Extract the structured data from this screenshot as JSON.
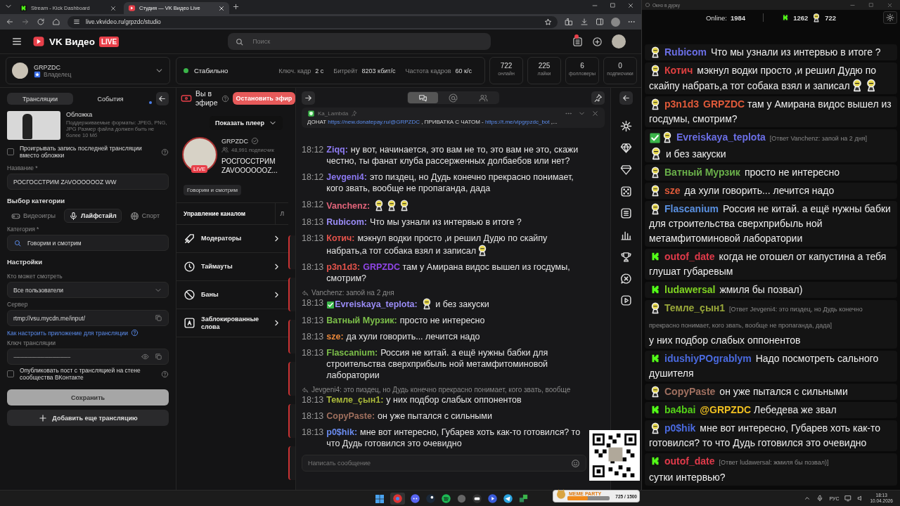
{
  "browser": {
    "tabs": [
      {
        "title": "Stream - Kick Dashboard",
        "kind": "kick",
        "selected": false
      },
      {
        "title": "Студия — VK Видео Live",
        "kind": "vk",
        "selected": true
      }
    ],
    "url": "live.vkvideo.ru/grpzdc/studio"
  },
  "header": {
    "logo": "VK Видео",
    "badge": "LIVE",
    "search": {
      "placeholder": "Поиск"
    }
  },
  "account": {
    "name": "GRPZDC",
    "role": "Владелец"
  },
  "status": {
    "label": "Стабильно",
    "metrics": [
      {
        "label": "Ключ. кадр",
        "value": "2 с"
      },
      {
        "label": "Битрейт",
        "value": "8203 кбит/с"
      },
      {
        "label": "Частота кадров",
        "value": "60 к/с"
      }
    ],
    "counters": [
      {
        "value": "722",
        "label": "онлайн"
      },
      {
        "value": "225",
        "label": "лайки"
      },
      {
        "value": "6",
        "label": "фолловеры"
      },
      {
        "value": "0",
        "label": "подписчики"
      }
    ]
  },
  "settings": {
    "tabs": [
      {
        "label": "Трансляции",
        "selected": true,
        "unread": false
      },
      {
        "label": "События",
        "selected": false,
        "unread": true
      }
    ],
    "cover": {
      "title": "Обложка",
      "hint": "Поддерживаемые форматы: JPEG, PNG, JPG Размер файла должен быть не более 10 Мб"
    },
    "replay_checkbox": {
      "label": "Проигрывать запись последней трансляции вместо обложки",
      "checked": false
    },
    "title_field": {
      "label": "Название *",
      "value": "РОСГОССТРИМ ZAVOOOOOOZ WW"
    },
    "category_section": "Выбор категории",
    "category_types": [
      {
        "label": "Видеоигры",
        "kind": "games",
        "selected": false
      },
      {
        "label": "Лайфстайл",
        "kind": "lifestyle",
        "selected": true
      },
      {
        "label": "Спорт",
        "kind": "sport",
        "selected": false
      }
    ],
    "category_field": {
      "label": "Категория *",
      "value": "Говорим и смотрим"
    },
    "settings_section": "Настройки",
    "audience_field": {
      "label": "Кто может смотреть",
      "value": "Все пользователи"
    },
    "server_field": {
      "label": "Сервер",
      "value": "rtmp://vsu.mycdn.me/input/"
    },
    "setup_link": "Как настроить приложение для трансляции",
    "key_field": {
      "label": "Ключ трансляции",
      "value": "--------------------------------------------"
    },
    "post_checkbox": {
      "label": "Опубликовать пост с трансляцией на стене сообщества ВКонтакте",
      "checked": false
    },
    "buttons": [
      {
        "label": "Сохранить",
        "kind": "primary"
      },
      {
        "label": "Добавить еще трансляцию",
        "kind": "add"
      }
    ]
  },
  "channel": {
    "live_label": "Вы в эфире",
    "stop_button": "Остановить эфир",
    "player_toggle": "Показать плеер",
    "name": "GRPZDC",
    "subscribers": "48,991 подписчик",
    "avatar_badge": "LIVE",
    "stream_title": "РОСГОССТРИМ ZAVOOOOOOZ...",
    "tag": "Говорим и смотрим",
    "manage_tabs": [
      {
        "label": "Управление каналом",
        "selected": true
      },
      {
        "label": "Л",
        "selected": false
      }
    ],
    "menu": [
      {
        "label": "Модераторы",
        "kind": "moderators"
      },
      {
        "label": "Таймауты",
        "kind": "timeouts"
      },
      {
        "label": "Баны",
        "kind": "bans"
      },
      {
        "label": "Заблокированные слова",
        "kind": "blocked_words"
      }
    ]
  },
  "chat": {
    "tabs": [
      {
        "kind": "chat",
        "selected": true
      },
      {
        "kind": "mentions",
        "selected": false
      },
      {
        "kind": "users",
        "selected": false
      }
    ],
    "pinned": {
      "author": "Ka_Lambda",
      "parts": [
        {
          "kind": "text",
          "text": "ДОНАТ "
        },
        {
          "kind": "link",
          "text": "https://new.donatepay.ru/@GRPZDC"
        },
        {
          "kind": "text",
          "text": " , ПРИВАТКА С ЧАТОМ - "
        },
        {
          "kind": "link",
          "text": "https://t.me/vipgrpzdc_bot"
        },
        {
          "kind": "text",
          "text": " ,..."
        }
      ]
    },
    "messages": [
      {
        "time": "18:12",
        "user": "Ziqq:",
        "color": "#8e7cf3",
        "parts": [
          {
            "kind": "text",
            "text": "ну вот, начинается, это вам не то, это вам не это, скажи честно, ты фанат клуба рассерженных долбаебов или нет?"
          }
        ]
      },
      {
        "time": "18:12",
        "user": "Jevgeni4:",
        "color": "#8a78f0",
        "parts": [
          {
            "kind": "text",
            "text": "это пиздец, но Дудь конечно прекрасно понимает, кого звать, вообще не пропаганда, дада"
          }
        ]
      },
      {
        "time": "18:12",
        "user": "Vanchenz:",
        "color": "#e2647a",
        "parts": [
          {
            "kind": "emote"
          },
          {
            "kind": "emote"
          },
          {
            "kind": "emote"
          }
        ]
      },
      {
        "time": "18:13",
        "user": "Rubicom:",
        "color": "#9a8cf6",
        "parts": [
          {
            "kind": "text",
            "text": "Что мы узнали из интервью в итоге ?"
          }
        ]
      },
      {
        "time": "18:13",
        "user": "Котич:",
        "color": "#e5534b",
        "parts": [
          {
            "kind": "text",
            "text": "мэкнул водки просто ,и решил Дудю по скайпу набрать,а тот собака взял и записал"
          },
          {
            "kind": "emote"
          }
        ]
      },
      {
        "time": "18:13",
        "user": "p3n1d3:",
        "color": "#e5534b",
        "parts": [
          {
            "kind": "mention",
            "text": "GRPZDC",
            "color": "#9146e8"
          },
          {
            "kind": "text",
            "text": " там у Амирана видос вышел из госдумы, смотрим?"
          }
        ]
      },
      {
        "time": "18:13",
        "user": "Evreiskaya_teplota:",
        "color": "#9a8cf6",
        "reply": "Vanchenz: запой на 2 дня",
        "verified": true,
        "parts": [
          {
            "kind": "emote"
          },
          {
            "kind": "text",
            "text": " и без закуски"
          }
        ]
      },
      {
        "time": "18:13",
        "user": "Ватный Мурзик:",
        "color": "#7cbf4a",
        "parts": [
          {
            "kind": "text",
            "text": "просто не интересно"
          }
        ]
      },
      {
        "time": "18:13",
        "user": "sze:",
        "color": "#e8873a",
        "parts": [
          {
            "kind": "text",
            "text": "да хули говорить... лечится надо"
          }
        ]
      },
      {
        "time": "18:13",
        "user": "Flascanium:",
        "color": "#7cbf4a",
        "parts": [
          {
            "kind": "text",
            "text": "Россия не китай. а ещё нужны бабки для строительства сверхприбыль ной метамфитоминовой лаборатории"
          }
        ]
      },
      {
        "time": "18:13",
        "user": "Темле_çын1:",
        "color": "#a9b83a",
        "reply": "Jevgeni4: это пиздец, но Дудь конечно прекрасно понимает, кого звать, вообще",
        "parts": [
          {
            "kind": "text",
            "text": "у них подбор слабых оппонентов"
          }
        ]
      },
      {
        "time": "18:13",
        "user": "CopyPaste:",
        "color": "#a0705e",
        "parts": [
          {
            "kind": "text",
            "text": "он уже пытался с сильными"
          }
        ]
      },
      {
        "time": "18:13",
        "user": "p0$hik:",
        "color": "#6a8cf0",
        "parts": [
          {
            "kind": "text",
            "text": "мне вот интересно, Губарев хоть как-то готовился? то что Дудь готовился это очевидно"
          }
        ]
      }
    ],
    "input": {
      "placeholder": "Написать сообщение"
    }
  },
  "overlay": {
    "window_title": "Окно в дурку",
    "online_label": "Online:",
    "online": "1984",
    "kick_count": "1262",
    "vk_count": "722",
    "messages": [
      {
        "kind": "vk",
        "user": "Rubicom",
        "color": "#6b6fe6",
        "parts": [
          {
            "kind": "text",
            "text": "Что мы узнали из интервью в итоге ?"
          }
        ]
      },
      {
        "kind": "vk",
        "user": "Котич",
        "color": "#e04040",
        "parts": [
          {
            "kind": "text",
            "text": "мэкнул водки просто ,и решил Дудю по скайпу набрать,а тот собака взял и записал"
          },
          {
            "kind": "emote"
          },
          {
            "kind": "emote"
          }
        ]
      },
      {
        "kind": "vk",
        "user": "p3n1d3",
        "color": "#e05a3a",
        "parts": [
          {
            "kind": "mention",
            "text": "GRPZDC",
            "color": "#e05a3a"
          },
          {
            "kind": "text",
            "text": " там у Амирана видос вышел из госдумы, смотрим?"
          }
        ]
      },
      {
        "kind": "vk",
        "user": "Evreiskaya_teplota",
        "color": "#6b6fe6",
        "verified": true,
        "reply": "[Ответ Vanchenz: запой на 2 дня]",
        "parts": [
          {
            "kind": "emote"
          },
          {
            "kind": "text",
            "text": " и без закуски"
          }
        ]
      },
      {
        "kind": "vk",
        "user": "Ватный Мурзик",
        "color": "#6ab04a",
        "parts": [
          {
            "kind": "text",
            "text": "просто не интересно"
          }
        ]
      },
      {
        "kind": "vk",
        "user": "sze",
        "color": "#e05a3a",
        "parts": [
          {
            "kind": "text",
            "text": "да хули говорить... лечится надо"
          }
        ]
      },
      {
        "kind": "vk",
        "user": "Flascanium",
        "color": "#5a90e0",
        "parts": [
          {
            "kind": "text",
            "text": "Россия не китай. а ещё нужны бабки для строительства сверхприбыль ной метамфитоминовой лаборатории"
          }
        ]
      },
      {
        "kind": "kick",
        "user": "outof_date",
        "color": "#e03a4a",
        "parts": [
          {
            "kind": "text",
            "text": "когда не отошел от капустина а тебя глушат губаревым"
          }
        ]
      },
      {
        "kind": "kick",
        "user": "ludawersal",
        "color": "#7ed321",
        "parts": [
          {
            "kind": "text",
            "text": "жмиля бы позвал)"
          }
        ]
      },
      {
        "kind": "vk",
        "user": "Темле_çын1",
        "color": "#9aa83a",
        "reply": "[Ответ Jevgeni4: это пиздец, но Дудь конечно прекрасно понимает, кого звать, вообще не пропаганда, дада]",
        "parts": [
          {
            "kind": "text",
            "text": "у них подбор слабых оппонентов"
          }
        ]
      },
      {
        "kind": "kick",
        "user": "idushiyPOgrablym",
        "color": "#4a6ae0",
        "parts": [
          {
            "kind": "text",
            "text": "Надо посмотреть сального душителя"
          }
        ]
      },
      {
        "kind": "vk",
        "user": "CopyPaste",
        "color": "#a07060",
        "parts": [
          {
            "kind": "text",
            "text": "он уже пытался с сильными"
          }
        ]
      },
      {
        "kind": "kick",
        "user": "ba4bai",
        "color": "#53d018",
        "parts": [
          {
            "kind": "mention",
            "text": "@GRPZDC",
            "color": "#f0c020"
          },
          {
            "kind": "text",
            "text": " Лебедева же звал"
          }
        ]
      },
      {
        "kind": "vk",
        "user": "p0$hik",
        "color": "#4a6ae0",
        "parts": [
          {
            "kind": "text",
            "text": "мне вот интересно, Губарев хоть как-то готовился? то что Дудь готовился это очевидно"
          }
        ]
      },
      {
        "kind": "kick",
        "user": "outof_date",
        "color": "#e03a4a",
        "reply": "[Ответ ludawersal: жмиля бы позвал)]",
        "parts": [
          {
            "kind": "text",
            "text": "сутки интервью?"
          }
        ]
      }
    ]
  },
  "stream_widget": {
    "title": "MEME PARTY",
    "reading": "725 / 1500",
    "level": 0.48
  },
  "tray": {
    "language": "РУС",
    "time": "18:13",
    "date": "10.04.2026"
  }
}
